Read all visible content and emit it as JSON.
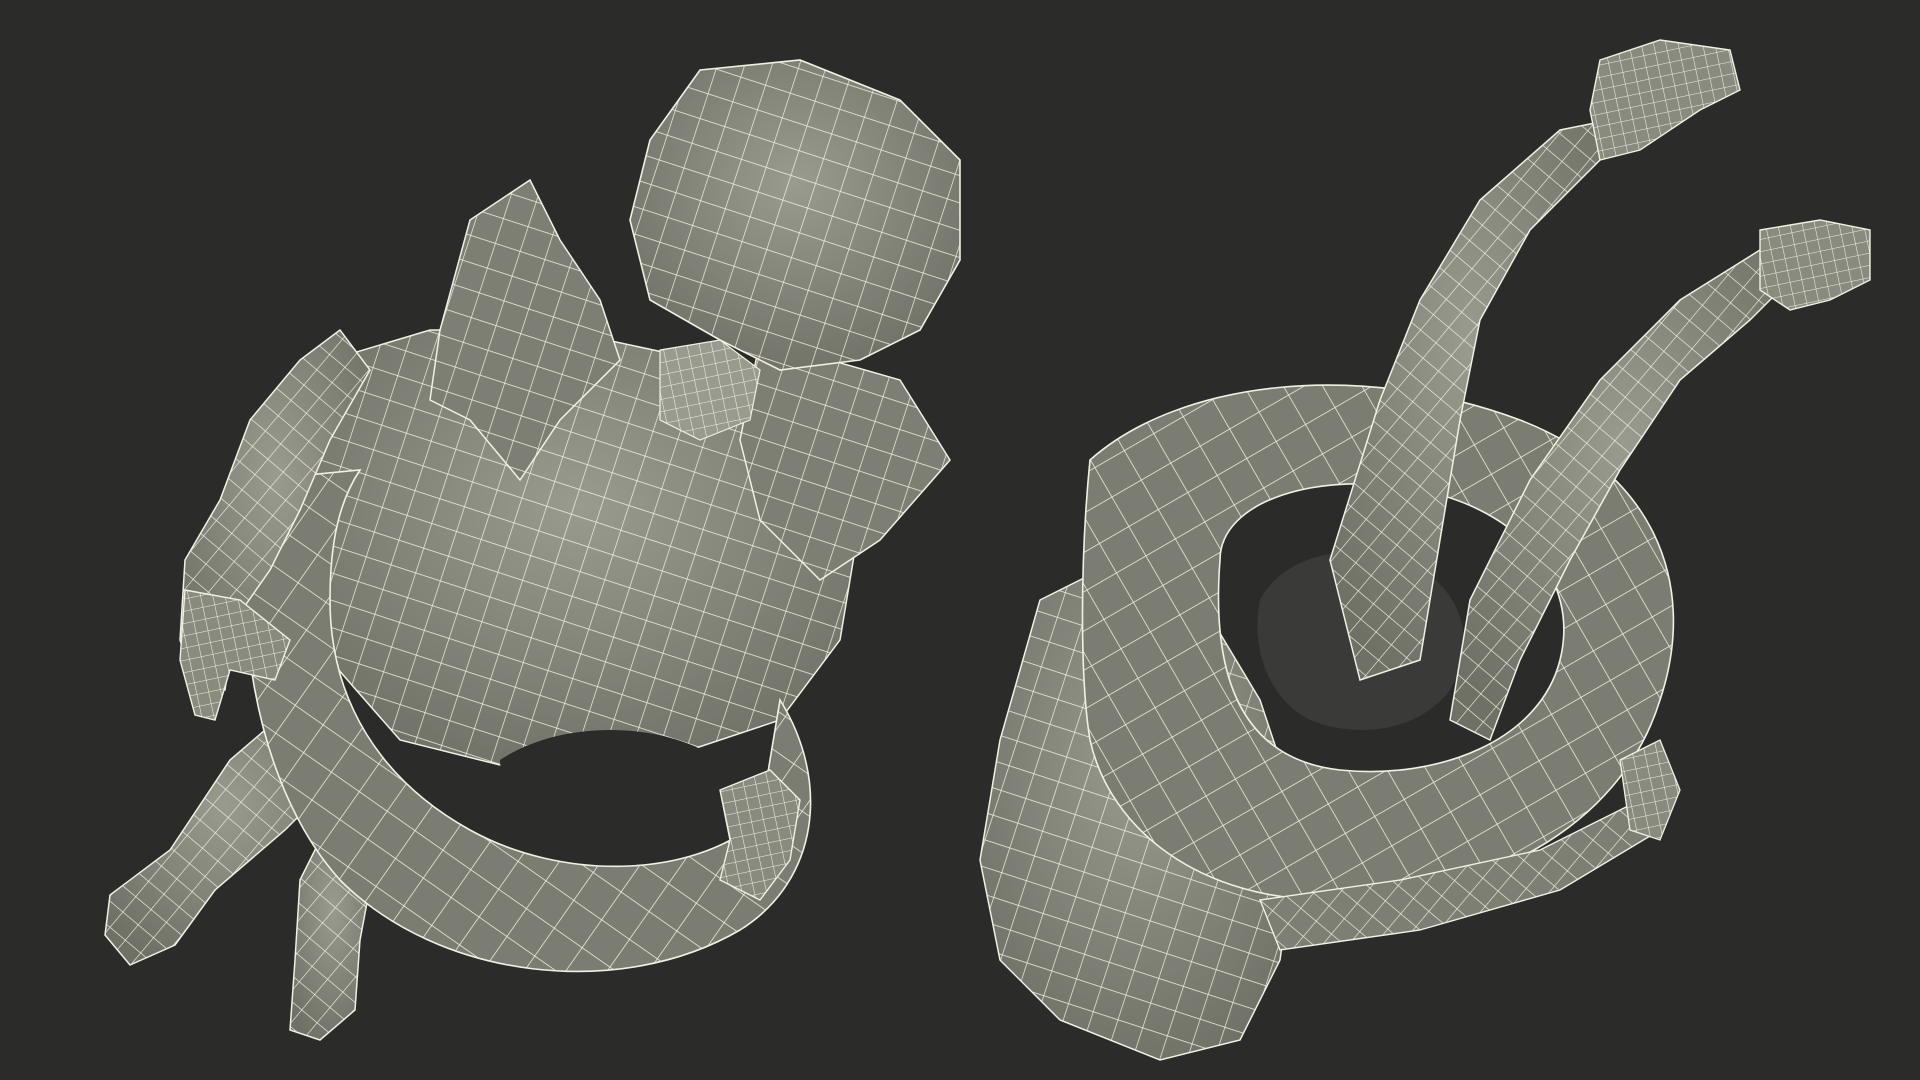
{
  "scene": {
    "background_color": "#2b2b2a",
    "mesh_fill_color": "#848579",
    "mesh_fill_shadow": "#6f7066",
    "mesh_fill_light": "#9a9b8f",
    "wire_color": "#f2f0e2",
    "views": [
      {
        "id": "view-left",
        "description_name": "top-down-view"
      },
      {
        "id": "view-right",
        "description_name": "bottom-up-view"
      }
    ]
  }
}
